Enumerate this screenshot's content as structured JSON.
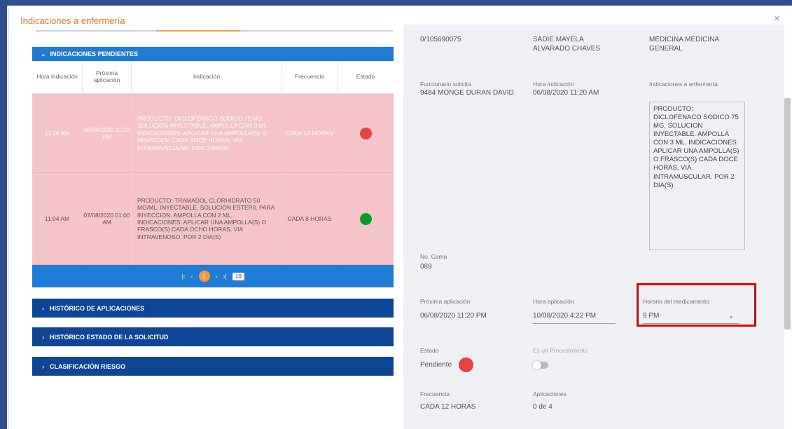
{
  "dialog": {
    "title": "Indicaciones a enfermería",
    "close_label": "×"
  },
  "pending": {
    "header": "INDICACIONES PENDIENTES",
    "columns": [
      "Hora indicación",
      "Próxima aplicación",
      "Indicación",
      "Frecuencia",
      "Estado"
    ],
    "rows": [
      {
        "hora": "11:20 AM",
        "proxima": "06/08/2020 11:20 PM",
        "indicacion": "PRODUCTO: DICLOFENACO SODICO 75 MG. SOLUCION INYECTABLE. AMPOLLA CON 3 ML. INDICACIONES: APLICAR UNA AMPOLLA(S) O FRASCO(S) CADA DOCE HORAS, VIA INTRAMUSCULAR. POR 2 DIA(S)",
        "frecuencia": "CADA 12 HORAS",
        "estado_color": "#e84141"
      },
      {
        "hora": "11:04 AM",
        "proxima": "07/08/2020 01:00 AM",
        "indicacion": "PRODUCTO: TRAMADOL CLORHIDRATO 50 MG/ML. INYECTABLE. SOLUCION ESTERIL PARA INYECCION. AMPOLLA CON 2 ML. INDICACIONES: APLICAR UNA AMPOLLA(S) O FRASCO(S) CADA OCHO HORAS, VIA INTRAVENOSO. POR 2 DIA(S)",
        "frecuencia": "CADA 8 HORAS",
        "estado_color": "#0a9a2a"
      }
    ],
    "pager": {
      "first": "|‹",
      "prev": "‹",
      "page": "1",
      "next": "›",
      "last": "›|",
      "page_size": "10"
    }
  },
  "accordions": [
    "HISTÓRICO DE APLICACIONES",
    "HISTÓRICO ESTADO DE LA SOLICITUD",
    "CLASIFICACIÓN RIESGO"
  ],
  "detail": {
    "top_id": "0/105690075",
    "top_patient": "SADIE MAYELA ALVARADO CHAVES",
    "top_service": "MEDICINA MEDICINA GENERAL",
    "funcionario_label": "Funcionario solicita",
    "funcionario_value": "9484 MONGE DURAN DAVID",
    "hora_ind_label": "Hora indicación",
    "hora_ind_value": "06/08/2020 11:20 AM",
    "ind_enf_label": "Indicaciones a enfermería",
    "ind_enf_value": "PRODUCTO: DICLOFENACO SODICO 75 MG. SOLUCION INYECTABLE. AMPOLLA CON 3 ML. INDICACIONES: APLICAR UNA AMPOLLA(S) O FRASCO(S) CADA DOCE HORAS, VIA INTRAMUSCULAR. POR 2 DIA(S)",
    "cama_label": "No. Cama",
    "cama_value": "089",
    "prox_label": "Próxima aplicación",
    "prox_value": "06/08/2020 11:20 PM",
    "hora_apl_label": "Hora aplicación",
    "hora_apl_value": "10/08/2020 4:22 PM",
    "horario_label": "Horario del medicamento",
    "horario_value": "9 PM",
    "estado_label": "Estado",
    "estado_value": "Pendiente",
    "procedimiento_label": "Es un Procedimiento",
    "frecuencia_label": "Frecuencia",
    "frecuencia_value": "CADA 12 HORAS",
    "aplicaciones_label": "Aplicaciones",
    "aplicaciones_value": "0 de 4"
  }
}
